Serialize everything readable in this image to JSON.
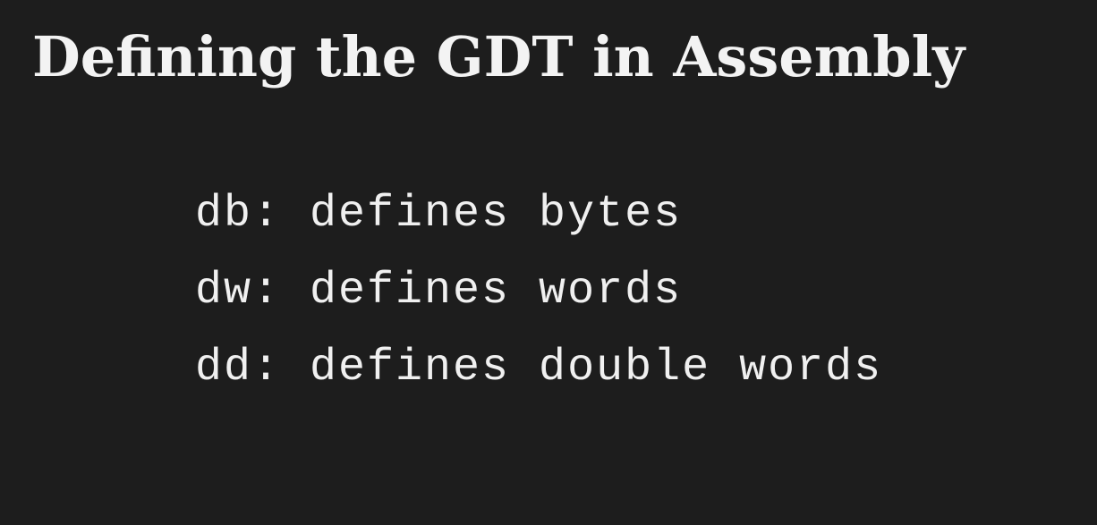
{
  "slide": {
    "title": "Defining the GDT in Assembly",
    "items": [
      "db: defines bytes",
      "dw: defines words",
      "dd: defines double words"
    ]
  },
  "colors": {
    "background": "#1d1d1d",
    "text": "#f2f2f2"
  }
}
